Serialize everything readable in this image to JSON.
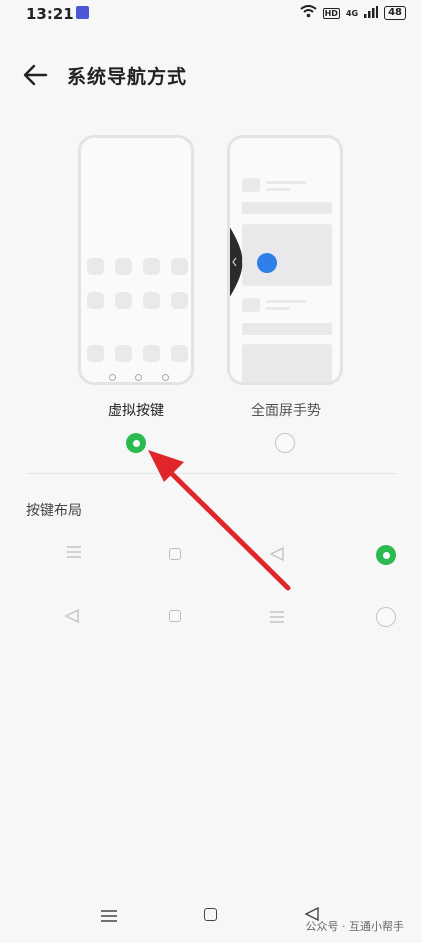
{
  "status_bar": {
    "time": "13:21",
    "network": "4G",
    "hd": "HD",
    "battery": "48"
  },
  "header": {
    "title": "系统导航方式"
  },
  "modes": [
    {
      "label": "虚拟按键",
      "selected": true
    },
    {
      "label": "全面屏手势",
      "selected": false
    }
  ],
  "section": {
    "title": "按键布局"
  },
  "layouts": [
    {
      "order": [
        "menu-icon",
        "square-icon",
        "triangle-left-icon"
      ],
      "selected": true
    },
    {
      "order": [
        "triangle-left-icon",
        "square-icon",
        "menu-icon"
      ],
      "selected": false
    }
  ],
  "watermark": "公众号 · 互通小帮手",
  "colors": {
    "accent": "#2bba4f",
    "gesture_dot": "#2e7fe8",
    "annotation_arrow": "#e0262b"
  }
}
